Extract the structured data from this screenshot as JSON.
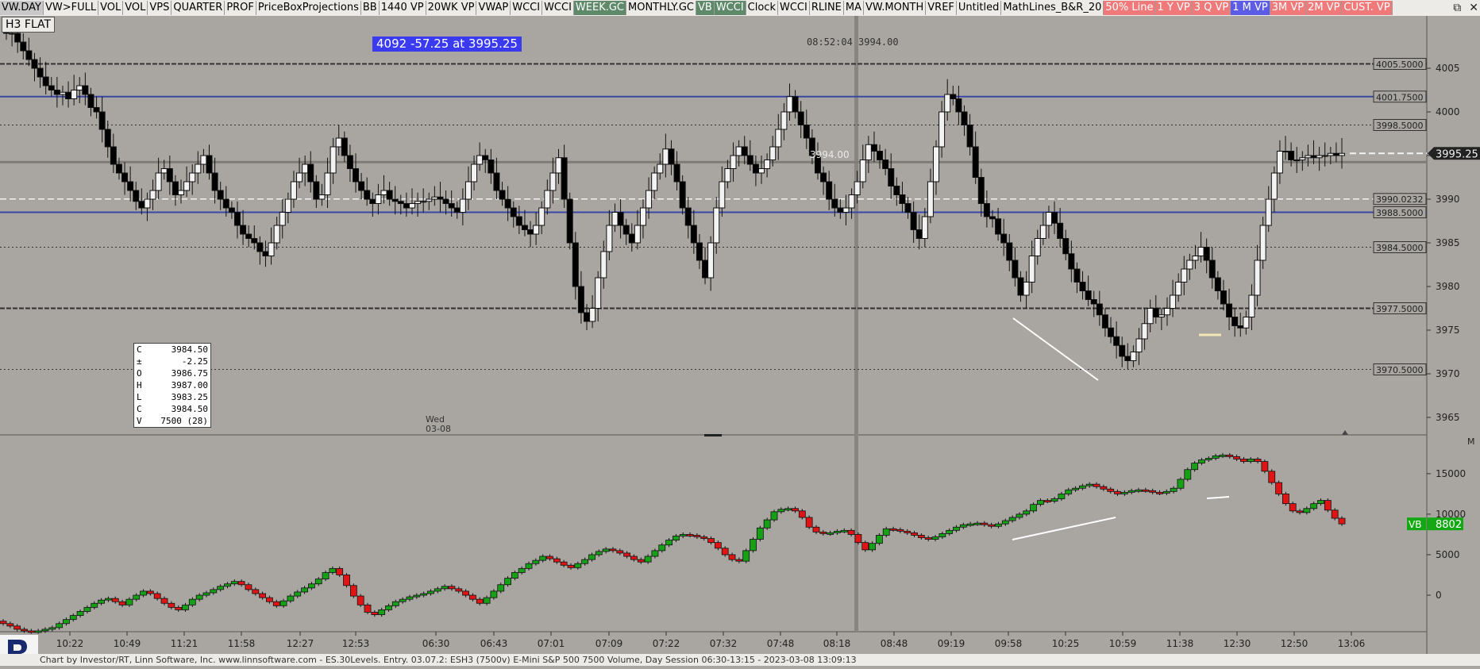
{
  "toolbar": {
    "buttons": [
      {
        "label": "VW.DAY",
        "style": "sel"
      },
      {
        "label": "VW>FULL",
        "style": ""
      },
      {
        "label": "VOL",
        "style": ""
      },
      {
        "label": "VOL",
        "style": ""
      },
      {
        "label": "VPS",
        "style": ""
      },
      {
        "label": "QUARTER",
        "style": ""
      },
      {
        "label": "PROF",
        "style": ""
      },
      {
        "label": "PriceBoxProjections",
        "style": ""
      },
      {
        "label": "BB",
        "style": ""
      },
      {
        "label": "1440 VP",
        "style": ""
      },
      {
        "label": "20WK VP",
        "style": ""
      },
      {
        "label": "VWAP",
        "style": ""
      },
      {
        "label": "WCCI",
        "style": ""
      },
      {
        "label": "WCCI",
        "style": ""
      },
      {
        "label": "WEEK.GC",
        "style": "g"
      },
      {
        "label": "MONTHLY.GC",
        "style": ""
      },
      {
        "label": "VB",
        "style": "g"
      },
      {
        "label": "WCCI",
        "style": "g"
      },
      {
        "label": "Clock",
        "style": ""
      },
      {
        "label": "WCCI",
        "style": ""
      },
      {
        "label": "RLINE",
        "style": ""
      },
      {
        "label": "MA",
        "style": ""
      },
      {
        "label": "VW.MONTH",
        "style": ""
      },
      {
        "label": "VREF",
        "style": ""
      },
      {
        "label": "Untitled",
        "style": ""
      },
      {
        "label": "MathLines_B&R_20",
        "style": ""
      },
      {
        "label": "50% Line",
        "style": "r"
      },
      {
        "label": "1 Y VP",
        "style": "r"
      },
      {
        "label": "3 Q VP",
        "style": "r"
      },
      {
        "label": "1 M VP",
        "style": "b"
      },
      {
        "label": "3M VP",
        "style": "r"
      },
      {
        "label": "2M VP",
        "style": "r"
      },
      {
        "label": "CUST. VP",
        "style": "r"
      }
    ]
  },
  "symbol_label": "H3 FLAT",
  "quote_box": "4092  -57.25 at 3995.25",
  "clock_readout": "08:52:04 3994.00",
  "cursor_price_label": "3994.00",
  "day_label": {
    "day": "Wed",
    "date": "03-08"
  },
  "data_window": {
    "rows": [
      {
        "k": "C",
        "v": "3984.50"
      },
      {
        "k": "±",
        "v": "-2.25"
      },
      {
        "k": "O",
        "v": "3986.75"
      },
      {
        "k": "H",
        "v": "3987.00"
      },
      {
        "k": "L",
        "v": "3983.25"
      },
      {
        "k": "C",
        "v": "3984.50"
      },
      {
        "k": "V",
        "v": "7500 (28)"
      }
    ]
  },
  "status_text": "Chart by Investor/RT, Linn Software, Inc. www.linnsoftware.com - ES.30Levels. Entry.     03.07.2: ESH3 (7500v) E-Mini S&P 500 7500 Volume, Day Session 06:30-13:15 - 2023-03-08 13:09:13",
  "colors": {
    "bg": "#a9a6a1",
    "up": "#f2f2f2",
    "down": "#000000",
    "level_blue": "#3a46a6",
    "vb_up": "#16a016",
    "vb_down": "#e01414",
    "vb_tag": "#15a815"
  },
  "chart_data": [
    {
      "type": "candlestick",
      "title": "",
      "ylim": [
        3963,
        4011
      ],
      "y_ticks": [
        3965,
        3970,
        3975,
        3980,
        3985,
        3990,
        3995,
        4000,
        4005
      ],
      "x_tick_labels": [
        "10:22",
        "10:49",
        "11:21",
        "11:58",
        "12:27",
        "12:53",
        "06:30",
        "06:43",
        "07:01",
        "07:09",
        "07:22",
        "07:32",
        "07:48",
        "08:18",
        "08:48",
        "09:19",
        "09:58",
        "10:25",
        "10:59",
        "11:38",
        "12:30",
        "12:50",
        "13:06"
      ],
      "last_price_label": "3995.25",
      "levels": [
        {
          "label": "4005.5000",
          "value": 4005.5,
          "style": "dash-dark"
        },
        {
          "label": "4001.7500",
          "value": 4001.75,
          "style": "blue"
        },
        {
          "label": "3998.5000",
          "value": 3998.5,
          "style": "dot"
        },
        {
          "label": "",
          "value": 3994.25,
          "style": "gray"
        },
        {
          "label": "3990.0232",
          "value": 3990.0232,
          "style": "dash-white"
        },
        {
          "label": "3988.5000",
          "value": 3988.5,
          "style": "blue"
        },
        {
          "label": "3984.5000",
          "value": 3984.5,
          "style": "dot"
        },
        {
          "label": "3977.5000",
          "value": 3977.5,
          "style": "dash-dark"
        },
        {
          "label": "3970.5000",
          "value": 3970.5,
          "style": "dot"
        }
      ],
      "close_path": [
        4009,
        4009,
        4008,
        4007,
        4006,
        4005,
        4004,
        4003,
        4002.5,
        4002,
        4002.25,
        4001.5,
        4002.5,
        4003,
        4002,
        4000.5,
        4000,
        3998,
        3996,
        3994,
        3993,
        3992,
        3991,
        3989.75,
        3989,
        3990,
        3991,
        3993,
        3993.5,
        3992,
        3990.5,
        3991,
        3992,
        3993,
        3994,
        3995,
        3993,
        3991,
        3990,
        3989,
        3988.5,
        3987,
        3986,
        3985.5,
        3985,
        3984,
        3983.5,
        3985,
        3987,
        3988.5,
        3990,
        3992,
        3993,
        3994,
        3992,
        3990,
        3990.5,
        3993,
        3996,
        3997,
        3995,
        3993.5,
        3992,
        3991,
        3990,
        3989.5,
        3990.5,
        3991,
        3990,
        3989.75,
        3989.5,
        3989,
        3989.5,
        3989.75,
        3989.75,
        3990,
        3990.25,
        3990,
        3989.5,
        3989,
        3988.5,
        3990,
        3992,
        3994,
        3995,
        3994.5,
        3993,
        3991,
        3990,
        3989,
        3988,
        3987,
        3986.5,
        3986,
        3987,
        3989,
        3991,
        3993,
        3994.75,
        3990,
        3985,
        3980,
        3977,
        3976,
        3977.5,
        3981,
        3984,
        3987,
        3988.5,
        3987,
        3986,
        3985,
        3987,
        3989,
        3991,
        3993,
        3994,
        3995.75,
        3994,
        3992,
        3989,
        3987,
        3985,
        3983,
        3981,
        3985,
        3989,
        3992,
        3993.5,
        3995,
        3996,
        3995,
        3994,
        3993,
        3993.5,
        3994.5,
        3996,
        3998,
        4000,
        4001.75,
        4000,
        3998.5,
        3997,
        3995,
        3993,
        3992,
        3990,
        3989,
        3988.5,
        3989,
        3990.5,
        3992,
        3994.5,
        3996.25,
        3995.5,
        3994.5,
        3993.5,
        3991.5,
        3990.5,
        3989.5,
        3988.5,
        3986.5,
        3985.5,
        3988,
        3992,
        3996,
        4000,
        4002,
        4001.5,
        4000,
        3998.5,
        3996,
        3992.5,
        3989.5,
        3988,
        3987.75,
        3986,
        3985,
        3983,
        3981,
        3979,
        3980.5,
        3983.5,
        3985.5,
        3987,
        3988.5,
        3987.25,
        3985.5,
        3983.75,
        3982,
        3980.5,
        3979.5,
        3978.5,
        3978,
        3976.75,
        3975.25,
        3974.25,
        3973.25,
        3972,
        3971.5,
        3972.5,
        3974,
        3975.75,
        3977.5,
        3976.5,
        3976.75,
        3977.5,
        3979,
        3980.5,
        3982,
        3983,
        3983.5,
        3984.5,
        3983,
        3981,
        3979.5,
        3978,
        3976.5,
        3975.5,
        3975.25,
        3976.5,
        3979,
        3983,
        3987,
        3990,
        3993,
        3995.5,
        3995.5,
        3994.5,
        3994.5,
        3994.75,
        3995,
        3994.75,
        3995,
        3995,
        3995.25,
        3995,
        3995.25
      ]
    },
    {
      "type": "line",
      "title": "",
      "name": "VB",
      "ylim": [
        -4500,
        19000
      ],
      "y_ticks": [
        0,
        5000,
        10000,
        15000
      ],
      "last_value_label": "8802",
      "panel_marker": "M",
      "values": [
        -3500,
        -3800,
        -4200,
        -4400,
        -4500,
        -4400,
        -4200,
        -4000,
        -3500,
        -3000,
        -2500,
        -2000,
        -1500,
        -1000,
        -600,
        -400,
        -800,
        -1200,
        -500,
        0,
        500,
        200,
        -400,
        -1000,
        -1500,
        -1800,
        -1200,
        -500,
        0,
        300,
        700,
        1100,
        1400,
        1700,
        1300,
        700,
        200,
        -300,
        -800,
        -1300,
        -700,
        -100,
        400,
        900,
        1400,
        2000,
        2800,
        3300,
        2500,
        1200,
        -100,
        -1200,
        -2100,
        -2400,
        -1800,
        -1300,
        -800,
        -500,
        -200,
        0,
        200,
        500,
        800,
        1100,
        800,
        500,
        0,
        -500,
        -1000,
        -300,
        500,
        1300,
        2100,
        2800,
        3300,
        3900,
        4300,
        4800,
        4500,
        4100,
        3700,
        3400,
        3900,
        4400,
        5000,
        5400,
        5700,
        5500,
        5200,
        4800,
        4400,
        4100,
        4800,
        5500,
        6200,
        6800,
        7300,
        7500,
        7400,
        7200,
        7000,
        6500,
        5800,
        5000,
        4400,
        4200,
        5500,
        6900,
        8300,
        9300,
        10300,
        10600,
        10700,
        10400,
        9600,
        8400,
        7800,
        7600,
        7700,
        7900,
        8000,
        7500,
        6500,
        5600,
        6400,
        7400,
        8200,
        8100,
        7900,
        7700,
        7400,
        7100,
        6900,
        7200,
        7600,
        8000,
        8400,
        8700,
        8800,
        8900,
        8700,
        8500,
        8800,
        9200,
        9600,
        10000,
        10400,
        11200,
        11700,
        11600,
        11900,
        12500,
        13000,
        13200,
        13500,
        13700,
        13400,
        13100,
        12800,
        12500,
        12700,
        12900,
        13000,
        12900,
        12700,
        12600,
        12800,
        13200,
        14300,
        15500,
        16300,
        16700,
        16900,
        17200,
        17300,
        17100,
        16800,
        16500,
        16800,
        16500,
        15300,
        13900,
        12500,
        11300,
        10400,
        10200,
        10700,
        11300,
        11700,
        10500,
        9500,
        8802
      ]
    }
  ]
}
